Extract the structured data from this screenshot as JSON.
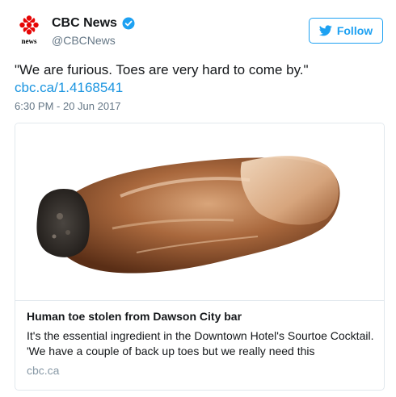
{
  "author": {
    "display_name": "CBC News",
    "handle": "@CBCNews",
    "avatar_wordmark": "news",
    "verified": true
  },
  "follow_button": {
    "label": "Follow",
    "icon": "twitter-bird-icon",
    "color": "#1da1f2"
  },
  "tweet": {
    "text": "\"We are furious. Toes are very hard to come by.\"",
    "link": "cbc.ca/1.4168541",
    "timestamp": "6:30 PM - 20 Jun 2017"
  },
  "card": {
    "image": "severed-toe-photo",
    "title": "Human toe stolen from Dawson City bar",
    "description": "It's the essential ingredient in the Downtown Hotel's Sourtoe Cocktail. 'We have a couple of back up toes but we really need this",
    "domain": "cbc.ca"
  },
  "colors": {
    "link": "#1b95e0",
    "brand_red": "#e60505",
    "muted": "#657786"
  }
}
